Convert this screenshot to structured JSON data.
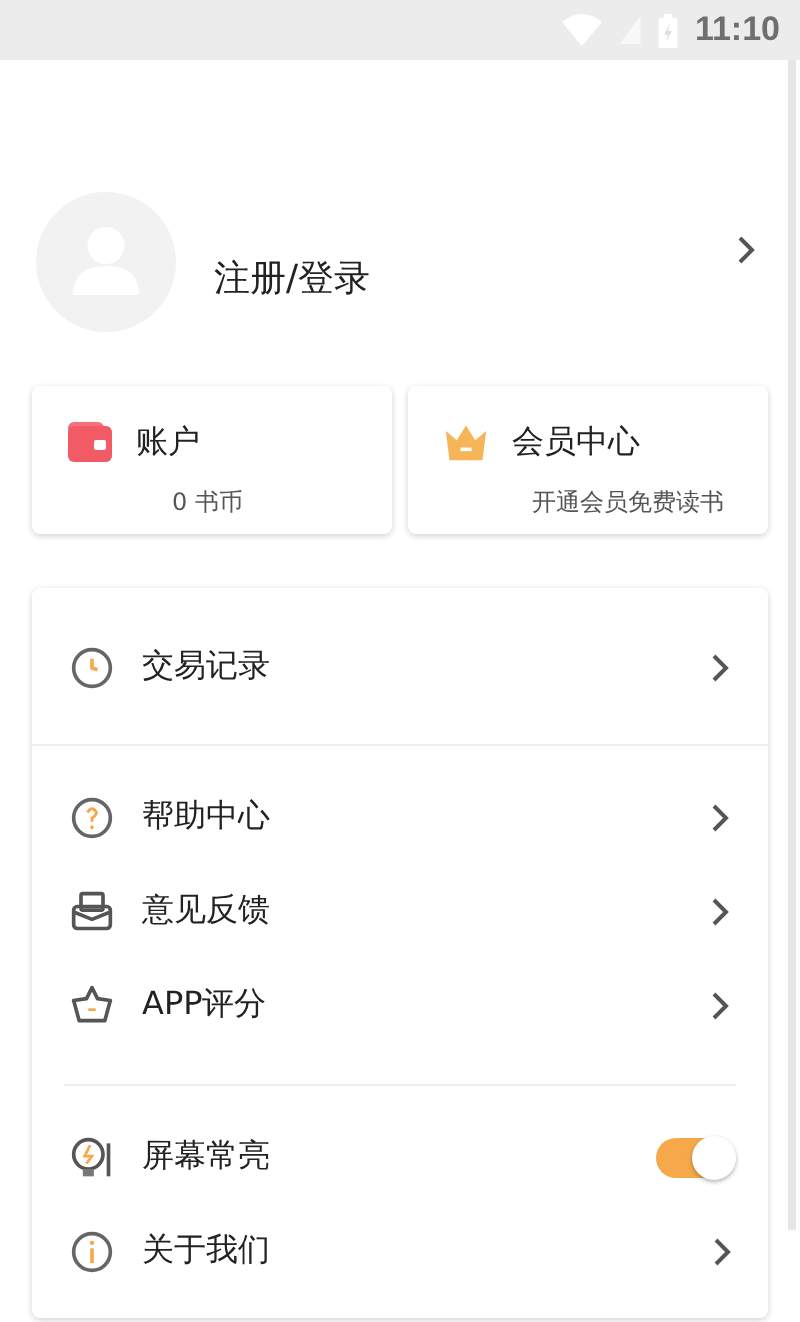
{
  "status_bar": {
    "time": "11:10"
  },
  "profile": {
    "name": "注册/登录"
  },
  "cards": [
    {
      "kind": "wallet",
      "title": "账户",
      "subtitle": "0 书币"
    },
    {
      "kind": "crown",
      "title": "会员中心",
      "subtitle": "开通会员免费读书"
    }
  ],
  "menu_groups": [
    {
      "items": [
        {
          "kind": "link",
          "label": "交易记录"
        }
      ]
    },
    {
      "items": [
        {
          "kind": "link",
          "label": "帮助中心"
        },
        {
          "kind": "link",
          "label": "意见反馈"
        },
        {
          "kind": "link",
          "label": "APP评分"
        }
      ]
    },
    {
      "items": [
        {
          "kind": "toggle",
          "label": "屏幕常亮",
          "on": true
        },
        {
          "kind": "link",
          "label": "关于我们"
        }
      ]
    }
  ]
}
